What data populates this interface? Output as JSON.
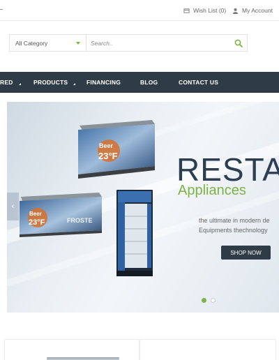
{
  "topbar": {
    "wishlist_label": "Wish List (0)",
    "account_label": "My Account"
  },
  "search": {
    "category_selected": "All Category",
    "placeholder": "Search.."
  },
  "nav": {
    "items": [
      "RED",
      "PRODUCTS",
      "FINANCING",
      "BLOG",
      "CONTACT US"
    ]
  },
  "slider": {
    "title": "RESTAU",
    "subtitle": "Appliances",
    "desc_line1": "the ultimate in modern de",
    "desc_line2": "Equipments thechnology",
    "button_label": "SHOP NOW",
    "current_slide": 1,
    "total_slides": 2,
    "product_label_beer": "Beer",
    "product_label_temp": "23°F",
    "product_label_brand": "FROSTE"
  },
  "colors": {
    "nav_bg": "#2f3b47",
    "accent_green": "#7cb342",
    "title_dark": "#2d3e50"
  }
}
